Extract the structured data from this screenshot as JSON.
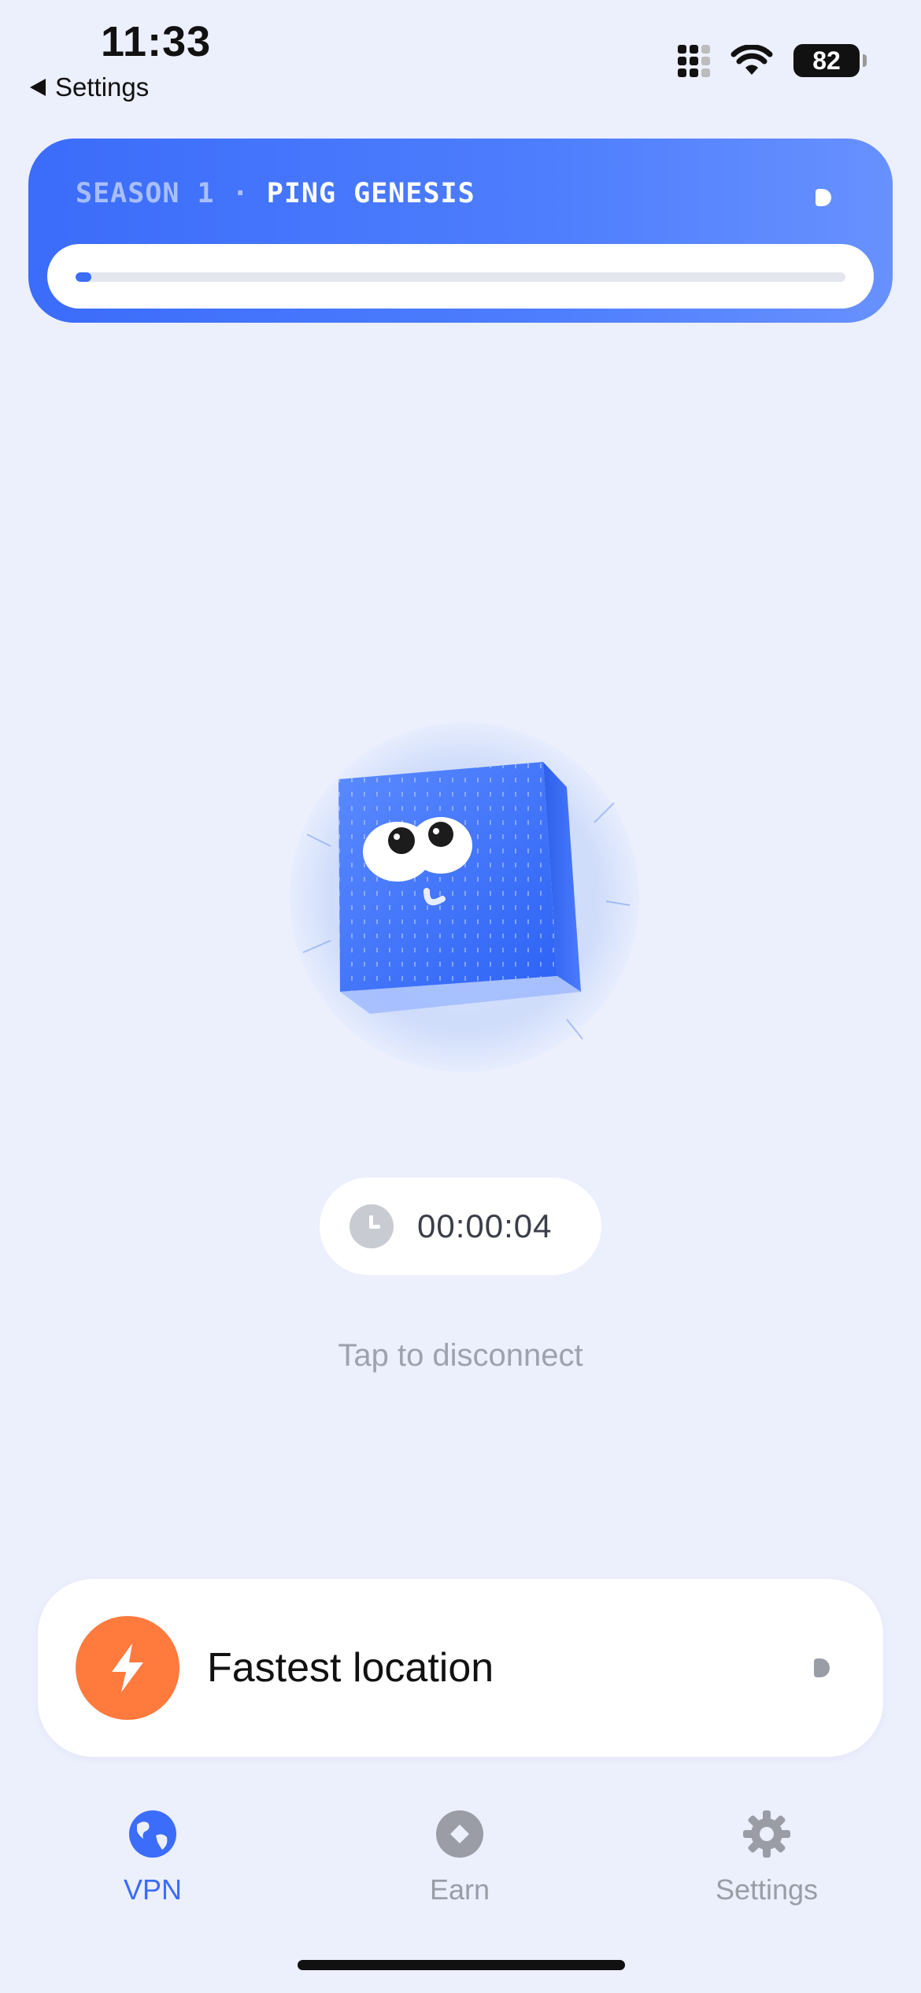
{
  "status_bar": {
    "time": "11:33",
    "back_label": "Settings",
    "battery": "82"
  },
  "season": {
    "label_prefix": "SEASON 1",
    "separator": " · ",
    "label_name": "PING GENESIS",
    "progress": 0.02,
    "accent_color": "#3B6CFA"
  },
  "mascot": {
    "icon": "cube-mascot-icon"
  },
  "connection": {
    "elapsed": "00:00:04",
    "hint": "Tap to disconnect"
  },
  "location": {
    "label": "Fastest location",
    "icon": "lightning-bolt-icon",
    "icon_color": "#FF7A3D"
  },
  "tabs": [
    {
      "label": "VPN",
      "icon": "globe-icon",
      "active": true
    },
    {
      "label": "Earn",
      "icon": "diamond-icon",
      "active": false
    },
    {
      "label": "Settings",
      "icon": "gear-icon",
      "active": false
    }
  ]
}
